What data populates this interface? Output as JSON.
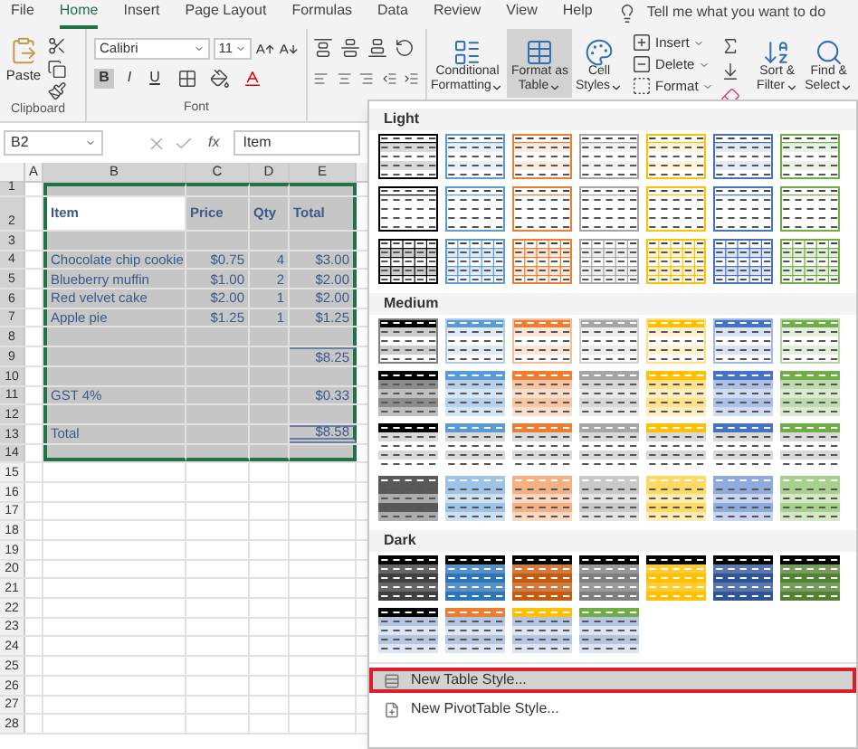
{
  "tabs": [
    {
      "label": "File",
      "selected": false
    },
    {
      "label": "Home",
      "selected": true
    },
    {
      "label": "Insert",
      "selected": false
    },
    {
      "label": "Page Layout",
      "selected": false
    },
    {
      "label": "Formulas",
      "selected": false
    },
    {
      "label": "Data",
      "selected": false
    },
    {
      "label": "Review",
      "selected": false
    },
    {
      "label": "View",
      "selected": false
    },
    {
      "label": "Help",
      "selected": false
    }
  ],
  "tell_me": "Tell me what you want to do",
  "clipboard": {
    "label": "Clipboard",
    "paste": "Paste"
  },
  "font": {
    "label": "Font",
    "name": "Calibri",
    "size": "11",
    "styles": [
      {
        "label": "B",
        "selected": true
      },
      {
        "label": "I",
        "selected": false
      },
      {
        "label": "U",
        "selected": false
      }
    ]
  },
  "styles": [
    {
      "lines": [
        "Conditional",
        "Formatting"
      ],
      "selected": false
    },
    {
      "lines": [
        "Format as",
        "Table"
      ],
      "selected": true
    },
    {
      "lines": [
        "Cell",
        "Styles"
      ],
      "selected": false
    }
  ],
  "cells": [
    "Insert",
    "Delete",
    "Format"
  ],
  "editing": [
    {
      "lines": [
        "Sort &",
        "Filter"
      ]
    },
    {
      "lines": [
        "Find &",
        "Select"
      ]
    }
  ],
  "formula_bar": {
    "name_box": "B2",
    "fx": "fx",
    "value": "Item"
  },
  "columns": [
    {
      "label": "A",
      "selected": false
    },
    {
      "label": "B",
      "selected": true
    },
    {
      "label": "C",
      "selected": true
    },
    {
      "label": "D",
      "selected": true
    },
    {
      "label": "E",
      "selected": true
    }
  ],
  "rows": [
    {
      "number": "1",
      "selected": true,
      "kind": "blank"
    },
    {
      "number": "2",
      "selected": true,
      "kind": "header",
      "item": {
        "text": "Item",
        "active": true
      },
      "price": {
        "text": "Price",
        "active": false
      },
      "qty": {
        "text": "Qty",
        "active": false
      },
      "total": {
        "text": "Total",
        "active": false
      }
    },
    {
      "number": "3",
      "selected": true,
      "kind": "blank"
    },
    {
      "number": "4",
      "selected": true,
      "kind": "line",
      "item": {
        "text": "Chocolate chip cookie",
        "active": false
      },
      "price": {
        "text": "$0.75",
        "active": false
      },
      "qty": {
        "text": "4",
        "active": false
      },
      "total": {
        "text": "$3.00",
        "active": false
      }
    },
    {
      "number": "5",
      "selected": true,
      "kind": "line",
      "item": {
        "text": "Blueberry muffin",
        "active": false
      },
      "price": {
        "text": "$1.00",
        "active": false
      },
      "qty": {
        "text": "2",
        "active": false
      },
      "total": {
        "text": "$2.00",
        "active": false
      }
    },
    {
      "number": "6",
      "selected": true,
      "kind": "line",
      "item": {
        "text": "Red velvet cake",
        "active": false
      },
      "price": {
        "text": "$2.00",
        "active": false
      },
      "qty": {
        "text": "1",
        "active": false
      },
      "total": {
        "text": "$2.00",
        "active": false
      }
    },
    {
      "number": "7",
      "selected": true,
      "kind": "line",
      "item": {
        "text": "Apple pie",
        "active": false
      },
      "price": {
        "text": "$1.25",
        "active": false
      },
      "qty": {
        "text": "1",
        "active": false
      },
      "total": {
        "text": "$1.25",
        "active": false
      }
    },
    {
      "number": "8",
      "selected": true,
      "kind": "blank"
    },
    {
      "number": "9",
      "selected": true,
      "kind": "subtotal",
      "total": {
        "text": "$8.25",
        "active": false
      }
    },
    {
      "number": "10",
      "selected": true,
      "kind": "blank"
    },
    {
      "number": "11",
      "selected": true,
      "kind": "line",
      "item": {
        "text": "GST  4%",
        "active": false
      },
      "total": {
        "text": "$0.33",
        "active": false
      }
    },
    {
      "number": "12",
      "selected": true,
      "kind": "blank"
    },
    {
      "number": "13",
      "selected": true,
      "kind": "total",
      "item": {
        "text": "Total",
        "active": false
      },
      "total": {
        "text": "$8.58",
        "active": false
      }
    },
    {
      "number": "14",
      "selected": true,
      "kind": "blank"
    },
    {
      "number": "15",
      "selected": false,
      "kind": "blank"
    },
    {
      "number": "16",
      "selected": false,
      "kind": "blank"
    },
    {
      "number": "17",
      "selected": false,
      "kind": "blank"
    },
    {
      "number": "18",
      "selected": false,
      "kind": "blank"
    },
    {
      "number": "19",
      "selected": false,
      "kind": "blank"
    },
    {
      "number": "20",
      "selected": false,
      "kind": "blank"
    },
    {
      "number": "21",
      "selected": false,
      "kind": "blank"
    },
    {
      "number": "22",
      "selected": false,
      "kind": "blank"
    },
    {
      "number": "23",
      "selected": false,
      "kind": "blank"
    },
    {
      "number": "24",
      "selected": false,
      "kind": "blank"
    },
    {
      "number": "25",
      "selected": false,
      "kind": "blank"
    },
    {
      "number": "26",
      "selected": false,
      "kind": "blank"
    },
    {
      "number": "27",
      "selected": false,
      "kind": "blank"
    },
    {
      "number": "28",
      "selected": false,
      "kind": "blank"
    }
  ],
  "gallery": {
    "sections": [
      {
        "label": "Light",
        "rows": [
          {
            "kind": "plain",
            "swatches": [
              {
                "color": "#000000"
              },
              {
                "color": "#5b9bd5"
              },
              {
                "color": "#ed7d31"
              },
              {
                "color": "#a5a5a5"
              },
              {
                "color": "#ffc000"
              },
              {
                "color": "#4472c4"
              },
              {
                "color": "#70ad47"
              }
            ]
          },
          {
            "kind": "outline",
            "swatches": [
              {
                "color": "#000000"
              },
              {
                "color": "#5b9bd5"
              },
              {
                "color": "#ed7d31"
              },
              {
                "color": "#a5a5a5"
              },
              {
                "color": "#ffc000"
              },
              {
                "color": "#4472c4"
              },
              {
                "color": "#70ad47"
              }
            ]
          },
          {
            "kind": "grid",
            "swatches": [
              {
                "color": "#000000"
              },
              {
                "color": "#5b9bd5"
              },
              {
                "color": "#ed7d31"
              },
              {
                "color": "#a5a5a5"
              },
              {
                "color": "#ffc000"
              },
              {
                "color": "#4472c4"
              },
              {
                "color": "#70ad47"
              }
            ]
          }
        ]
      },
      {
        "label": "Medium",
        "rows": [
          {
            "kind": "header",
            "swatches": [
              {
                "color": "#000000"
              },
              {
                "color": "#5b9bd5"
              },
              {
                "color": "#ed7d31"
              },
              {
                "color": "#a5a5a5"
              },
              {
                "color": "#ffc000"
              },
              {
                "color": "#4472c4"
              },
              {
                "color": "#70ad47"
              }
            ]
          },
          {
            "kind": "banded",
            "swatches": [
              {
                "color": "#000000"
              },
              {
                "color": "#5b9bd5"
              },
              {
                "color": "#ed7d31"
              },
              {
                "color": "#a5a5a5"
              },
              {
                "color": "#ffc000"
              },
              {
                "color": "#4472c4"
              },
              {
                "color": "#70ad47"
              }
            ]
          },
          {
            "kind": "rule",
            "swatches": [
              {
                "color": "#000000"
              },
              {
                "color": "#5b9bd5"
              },
              {
                "color": "#ed7d31"
              },
              {
                "color": "#a5a5a5"
              },
              {
                "color": "#ffc000"
              },
              {
                "color": "#4472c4"
              },
              {
                "color": "#70ad47"
              }
            ]
          },
          {
            "kind": "tint",
            "swatches": [
              {
                "color": "#595959"
              },
              {
                "color": "#9dc3e6"
              },
              {
                "color": "#f4b183"
              },
              {
                "color": "#c9c9c9"
              },
              {
                "color": "#ffd966"
              },
              {
                "color": "#8faadc"
              },
              {
                "color": "#a9d18e"
              }
            ]
          }
        ]
      },
      {
        "label": "Dark",
        "rows": [
          {
            "kind": "dark",
            "swatches": [
              {
                "color": "#404040"
              },
              {
                "color": "#2e75b6"
              },
              {
                "color": "#c55a11"
              },
              {
                "color": "#7f7f7f"
              },
              {
                "color": "#ffc000"
              },
              {
                "color": "#2f5597"
              },
              {
                "color": "#548235"
              }
            ]
          },
          {
            "kind": "dark-header",
            "swatches": [
              {
                "color": "#000000"
              },
              {
                "color": "#ed7d31"
              },
              {
                "color": "#ffc000"
              },
              {
                "color": "#70ad47"
              }
            ]
          }
        ]
      }
    ],
    "menu": [
      {
        "label": "New Table Style...",
        "selected": true
      },
      {
        "label": "New PivotTable Style...",
        "selected": false
      }
    ]
  }
}
